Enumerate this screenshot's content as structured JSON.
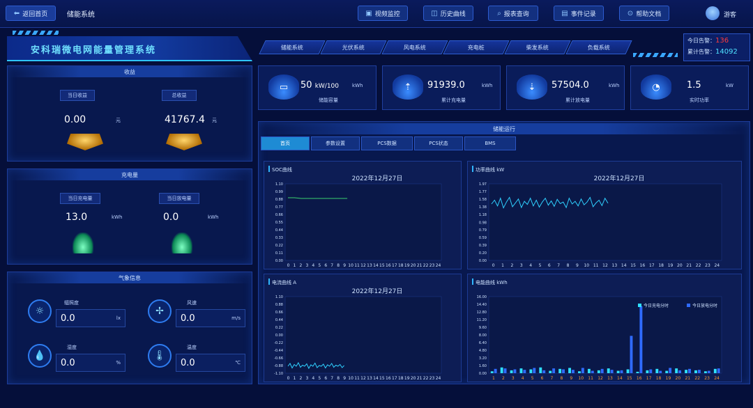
{
  "topbar": {
    "home_label": "返回首页",
    "system_label": "储能系统",
    "buttons": [
      {
        "label": "视频监控",
        "icon": "video-icon"
      },
      {
        "label": "历史曲线",
        "icon": "history-icon"
      },
      {
        "label": "报表查询",
        "icon": "report-icon"
      },
      {
        "label": "事件记录",
        "icon": "event-icon"
      },
      {
        "label": "帮助文档",
        "icon": "help-icon"
      }
    ],
    "user_name": "游客"
  },
  "banner": {
    "title": "安科瑞微电网能量管理系统",
    "nav_tabs": [
      "储能系统",
      "光伏系统",
      "风电系统",
      "充电桩",
      "柴发系统",
      "负载系统"
    ],
    "alarm_today_label": "今日告警：",
    "alarm_today_value": "136",
    "alarm_total_label": "累计告警：",
    "alarm_total_value": "14092"
  },
  "income": {
    "title": "收益",
    "today_label": "当日收益",
    "today_value": "0.00",
    "total_label": "总收益",
    "total_value": "41767.4",
    "unit": "元"
  },
  "charge": {
    "title": "充电量",
    "today_charge_label": "当日充电量",
    "today_charge_value": "13.0",
    "today_discharge_label": "当日放电量",
    "today_discharge_value": "0.0",
    "unit": "kWh"
  },
  "weather": {
    "title": "气象信息",
    "items": [
      {
        "label": "辐照度",
        "value": "0.0",
        "unit": "lx",
        "icon": "sun-icon"
      },
      {
        "label": "风速",
        "value": "0.0",
        "unit": "m/s",
        "icon": "fan-icon"
      },
      {
        "label": "湿度",
        "value": "0.0",
        "unit": "%",
        "icon": "humidity-icon"
      },
      {
        "label": "温度",
        "value": "0.0",
        "unit": "℃",
        "icon": "thermometer-icon"
      }
    ]
  },
  "kpis": [
    {
      "value": "50",
      "value2": "kW/100",
      "unit": "kWh",
      "caption": "储能容量"
    },
    {
      "value": "91939.0",
      "value2": "",
      "unit": "kWh",
      "caption": "累计充电量"
    },
    {
      "value": "57504.0",
      "value2": "",
      "unit": "kWh",
      "caption": "累计放电量"
    },
    {
      "value": "1.5",
      "value2": "",
      "unit": "kW",
      "caption": "实时功率"
    }
  ],
  "operation": {
    "title": "储能运行",
    "tabs": [
      "首页",
      "参数设置",
      "PCS数据",
      "PCS状态",
      "BMS"
    ],
    "active_tab": 0
  },
  "chart_data": [
    {
      "type": "line",
      "title": "SOC曲线",
      "date": "2022年12月27日",
      "x": [
        "0",
        "1",
        "2",
        "3",
        "4",
        "5",
        "6",
        "7",
        "8",
        "9",
        "10",
        "11",
        "12",
        "13",
        "14",
        "15",
        "16",
        "17",
        "18",
        "19",
        "20",
        "21",
        "22",
        "23",
        "24"
      ],
      "ylim": [
        0.0,
        1.1
      ],
      "yticks": [
        "0.00",
        "0.11",
        "0.22",
        "0.33",
        "0.44",
        "0.55",
        "0.66",
        "0.77",
        "0.88",
        "0.99",
        "1.10"
      ],
      "series": [
        {
          "values": [
            0.9,
            0.9,
            0.89,
            0.89,
            0.89,
            0.89,
            0.89,
            0.89,
            0.89,
            0.89
          ]
        }
      ],
      "color": "#3bd16f"
    },
    {
      "type": "line",
      "title": "功率曲线",
      "unit": "kW",
      "date": "2022年12月27日",
      "x": [
        "0",
        "1",
        "2",
        "3",
        "4",
        "5",
        "6",
        "7",
        "8",
        "9",
        "10",
        "11",
        "12",
        "13",
        "14",
        "15",
        "16",
        "17",
        "18",
        "19",
        "20",
        "21",
        "22",
        "23",
        "24"
      ],
      "ylim": [
        0.0,
        1.97
      ],
      "yticks": [
        "0.00",
        "0.20",
        "0.39",
        "0.59",
        "0.79",
        "0.98",
        "1.18",
        "1.38",
        "1.58",
        "1.77",
        "1.97"
      ],
      "series": [
        {
          "values": [
            1.45,
            1.55,
            1.4,
            1.6,
            1.35,
            1.5,
            1.62,
            1.38,
            1.48,
            1.58,
            1.36,
            1.52,
            1.44,
            1.6,
            1.4,
            1.55,
            1.37,
            1.5,
            1.6,
            1.42,
            1.53,
            1.39,
            1.57,
            1.46,
            1.5,
            1.36,
            1.6,
            1.45,
            1.52,
            1.4,
            1.58,
            1.43,
            1.5,
            1.62,
            1.38,
            1.48,
            1.55,
            1.41,
            1.6,
            1.47
          ]
        }
      ],
      "color": "#2fd0ff"
    },
    {
      "type": "line",
      "title": "电流曲线",
      "unit": "A",
      "date": "2022年12月27日",
      "x": [
        "0",
        "1",
        "2",
        "3",
        "4",
        "5",
        "6",
        "7",
        "8",
        "9",
        "10",
        "11",
        "12",
        "13",
        "14",
        "15",
        "16",
        "17",
        "18",
        "19",
        "20",
        "21",
        "22",
        "23",
        "24"
      ],
      "ylim": [
        -1.1,
        1.1
      ],
      "yticks": [
        "-1.10",
        "-0.88",
        "-0.66",
        "-0.44",
        "-0.22",
        "0.00",
        "0.22",
        "0.44",
        "0.66",
        "0.88",
        "1.10"
      ],
      "series": [
        {
          "values": [
            -0.9,
            -0.82,
            -0.95,
            -0.85,
            -0.9,
            -0.8,
            -0.93,
            -0.87,
            -0.9,
            -0.83,
            -0.96,
            -0.86,
            -0.9,
            -0.81,
            -0.94,
            -0.88,
            -0.9,
            -0.84,
            -0.95,
            -0.86,
            -0.9,
            -0.82,
            -0.93,
            -0.87,
            -0.9,
            -0.85,
            -0.94,
            -0.88
          ]
        }
      ],
      "color": "#2fd0ff"
    },
    {
      "type": "bar",
      "title": "电能曲线",
      "unit": "kWh",
      "categories": [
        "1",
        "2",
        "3",
        "4",
        "5",
        "6",
        "7",
        "8",
        "9",
        "10",
        "11",
        "12",
        "13",
        "14",
        "15",
        "16",
        "17",
        "18",
        "19",
        "20",
        "21",
        "22",
        "23",
        "24"
      ],
      "ylim": [
        0.0,
        16.0
      ],
      "yticks": [
        "0.00",
        "1.60",
        "3.20",
        "4.80",
        "6.40",
        "8.00",
        "9.60",
        "11.20",
        "12.80",
        "14.40",
        "16.00"
      ],
      "legend": [
        "今日充电分时",
        "今日放电分时"
      ],
      "series": [
        {
          "name": "今日充电分时",
          "values": [
            0.4,
            1.2,
            0.6,
            1.0,
            0.8,
            1.2,
            0.5,
            0.9,
            1.1,
            0.4,
            0.9,
            0.6,
            1.0,
            0.5,
            0.8,
            0.3,
            0.6,
            0.9,
            0.5,
            1.0,
            0.7,
            0.6,
            0.4,
            0.9
          ]
        },
        {
          "name": "今日放电分时",
          "values": [
            0.9,
            1.0,
            0.8,
            0.7,
            1.1,
            0.6,
            1.0,
            0.8,
            0.7,
            1.1,
            0.5,
            0.9,
            0.7,
            0.6,
            7.8,
            14.0,
            0.8,
            0.5,
            1.1,
            0.6,
            0.9,
            0.7,
            0.5,
            1.0
          ]
        }
      ],
      "colors": [
        "#2fe0ff",
        "#2f6bff"
      ]
    }
  ]
}
